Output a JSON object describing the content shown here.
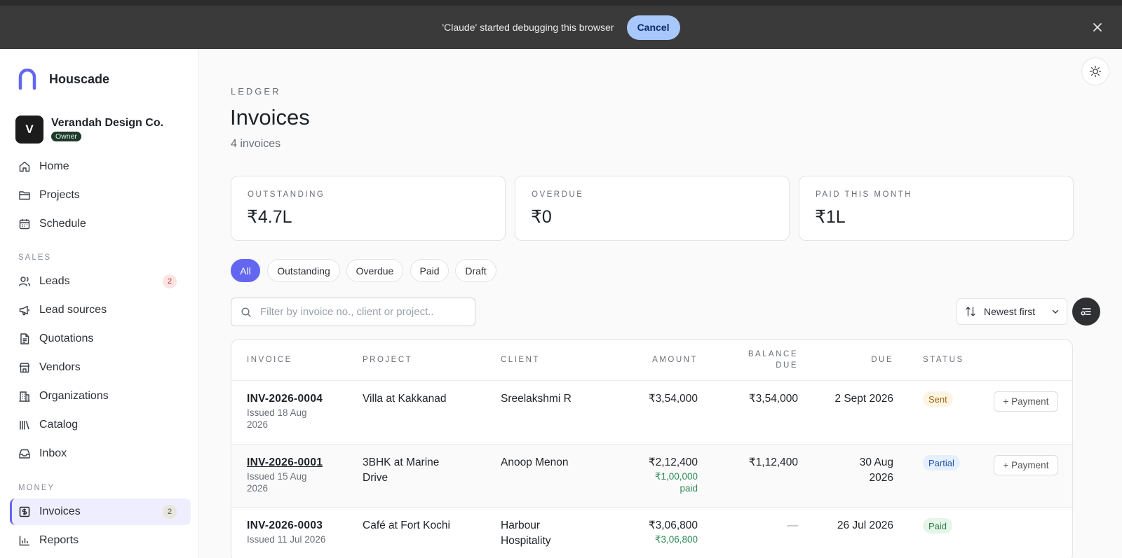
{
  "debug_bar": {
    "message": "'Claude' started debugging this browser",
    "cancel_label": "Cancel"
  },
  "brand": {
    "name": "Houscade"
  },
  "org": {
    "avatar_letter": "V",
    "name": "Verandah Design Co.",
    "role": "Owner"
  },
  "nav": {
    "top": [
      {
        "label": "Home",
        "icon": "home-icon"
      },
      {
        "label": "Projects",
        "icon": "folder-icon"
      },
      {
        "label": "Schedule",
        "icon": "calendar-icon"
      }
    ],
    "sales_label": "SALES",
    "sales": [
      {
        "label": "Leads",
        "icon": "users-icon",
        "badge": "2"
      },
      {
        "label": "Lead sources",
        "icon": "megaphone-icon"
      },
      {
        "label": "Quotations",
        "icon": "document-icon"
      },
      {
        "label": "Vendors",
        "icon": "store-icon"
      },
      {
        "label": "Organizations",
        "icon": "building-icon"
      },
      {
        "label": "Catalog",
        "icon": "library-icon"
      },
      {
        "label": "Inbox",
        "icon": "inbox-icon"
      }
    ],
    "money_label": "MONEY",
    "money": [
      {
        "label": "Invoices",
        "icon": "invoice-icon",
        "badge": "2",
        "active": true
      },
      {
        "label": "Reports",
        "icon": "bar-chart-icon"
      }
    ]
  },
  "page": {
    "eyebrow": "LEDGER",
    "title": "Invoices",
    "subtitle": "4 invoices"
  },
  "stats": [
    {
      "label": "OUTSTANDING",
      "value": "₹4.7L"
    },
    {
      "label": "OVERDUE",
      "value": "₹0"
    },
    {
      "label": "PAID THIS MONTH",
      "value": "₹1L"
    }
  ],
  "filters": [
    "All",
    "Outstanding",
    "Overdue",
    "Paid",
    "Draft"
  ],
  "active_filter": "All",
  "search": {
    "placeholder": "Filter by invoice no., client or project.."
  },
  "sort": {
    "selected": "Newest first"
  },
  "table": {
    "headers": {
      "invoice": "INVOICE",
      "project": "PROJECT",
      "client": "CLIENT",
      "amount": "AMOUNT",
      "balance_1": "BALANCE",
      "balance_2": "DUE",
      "due": "DUE",
      "status": "STATUS"
    },
    "rows": [
      {
        "invoice": "INV-2026-0004",
        "issued_1": "Issued 18 Aug",
        "issued_2": "2026",
        "project_1": "Villa at Kakkanad",
        "project_2": "",
        "client_1": "Sreelakshmi R",
        "client_2": "",
        "amount": "₹3,54,000",
        "paid_1": "",
        "paid_2": "",
        "balance": "₹3,54,000",
        "due_1": "2 Sept 2026",
        "due_2": "",
        "status": "Sent",
        "action": "+ Payment"
      },
      {
        "invoice": "INV-2026-0001",
        "issued_1": "Issued 15 Aug",
        "issued_2": "2026",
        "project_1": "3BHK at Marine",
        "project_2": "Drive",
        "client_1": "Anoop Menon",
        "client_2": "",
        "amount": "₹2,12,400",
        "paid_1": "₹1,00,000",
        "paid_2": "paid",
        "balance": "₹1,12,400",
        "due_1": "30 Aug",
        "due_2": "2026",
        "status": "Partial",
        "action": "+ Payment"
      },
      {
        "invoice": "INV-2026-0003",
        "issued_1": "Issued 11 Jul 2026",
        "issued_2": "",
        "project_1": "Café at Fort Kochi",
        "project_2": "",
        "client_1": "Harbour",
        "client_2": "Hospitality",
        "amount": "₹3,06,800",
        "paid_1": "₹3,06,800",
        "paid_2": "",
        "balance": "—",
        "due_1": "26 Jul 2026",
        "due_2": "",
        "status": "Paid",
        "action": ""
      }
    ]
  }
}
